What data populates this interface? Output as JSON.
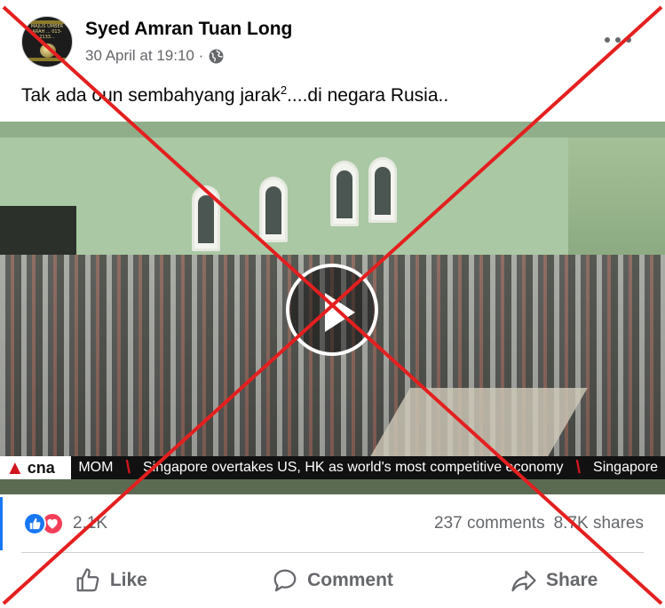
{
  "post": {
    "author": "Syed Amran Tuan Long",
    "timestamp": "30 April at 19:10 ·",
    "privacy_icon": "globe-icon",
    "text_before": "Tak ada oun sembahyang jarak",
    "text_sup": "2",
    "text_after": "....di negara Rusia..",
    "more_icon": "more-options-icon"
  },
  "avatar": {
    "lines": "MAJLIS UMBER ARAH ... 013-2133..."
  },
  "video": {
    "play_icon": "play-icon",
    "ticker": {
      "logo": "cna",
      "items": [
        "MOM",
        "Singapore overtakes US, HK as world's most competitive economy",
        "Singapore"
      ]
    }
  },
  "engagement": {
    "reaction_icons": [
      "like-reaction-icon",
      "love-reaction-icon"
    ],
    "reaction_count": "2.1K",
    "comments": "237 comments",
    "shares": "8.7K shares"
  },
  "actions": {
    "like": "Like",
    "comment": "Comment",
    "share": "Share"
  },
  "overlay": {
    "type": "red-x-cross",
    "color": "#e41f1f"
  },
  "colors": {
    "accent": "#1877f2",
    "love": "#f33e58",
    "muted_text": "#65676b"
  }
}
